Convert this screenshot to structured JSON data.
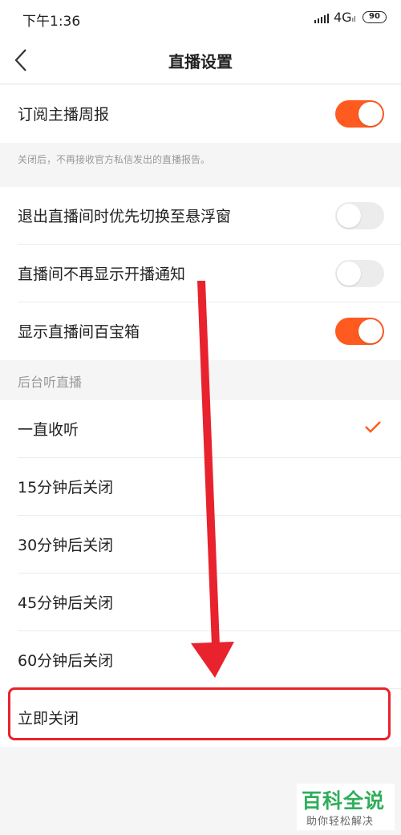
{
  "status_bar": {
    "time": "下午1:36",
    "network": "4G",
    "network_sub": "ıl",
    "battery": "90"
  },
  "header": {
    "title": "直播设置"
  },
  "subscribe": {
    "label": "订阅主播周报",
    "enabled": true,
    "hint": "关闭后，不再接收官方私信发出的直播报告。"
  },
  "toggles": [
    {
      "label": "退出直播间时优先切换至悬浮窗",
      "enabled": false
    },
    {
      "label": "直播间不再显示开播通知",
      "enabled": false
    },
    {
      "label": "显示直播间百宝箱",
      "enabled": true
    }
  ],
  "background_listen": {
    "section_title": "后台听直播",
    "options": [
      {
        "label": "一直收听",
        "selected": true
      },
      {
        "label": "15分钟后关闭",
        "selected": false
      },
      {
        "label": "30分钟后关闭",
        "selected": false
      },
      {
        "label": "45分钟后关闭",
        "selected": false
      },
      {
        "label": "60分钟后关闭",
        "selected": false
      },
      {
        "label": "立即关闭",
        "selected": false
      }
    ]
  },
  "watermark": {
    "main": "百科全说",
    "sub": "助你轻松解决"
  },
  "colors": {
    "accent": "#ff5a1f",
    "annotation": "#e8232d",
    "watermark": "#2fae5a"
  }
}
